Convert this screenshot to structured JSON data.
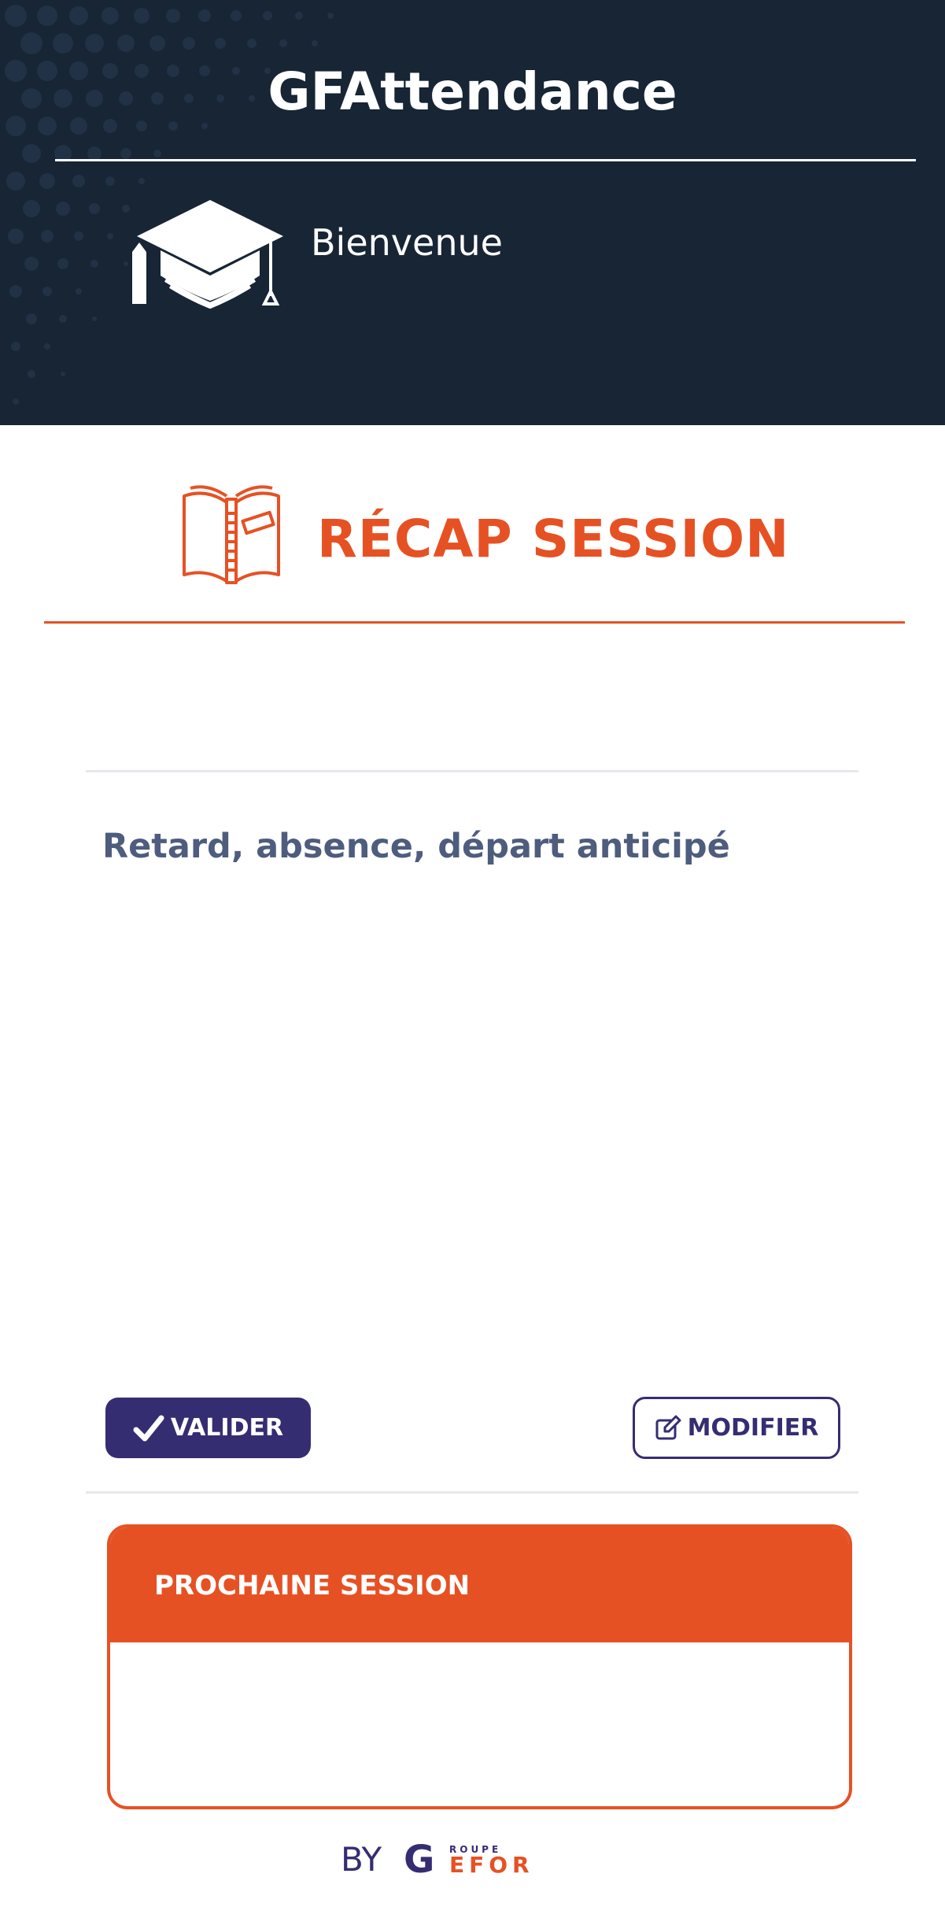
{
  "header": {
    "app_title": "GFAttendance",
    "welcome": "Bienvenue"
  },
  "recap": {
    "title": "RÉCAP SESSION",
    "subheading": "Retard, absence, départ anticipé"
  },
  "actions": {
    "validate_label": "VALIDER",
    "modify_label": "MODIFIER"
  },
  "next_session": {
    "title": "PROCHAINE SESSION"
  },
  "footer": {
    "by": "BY",
    "brand_small": "ROUPE",
    "brand_g": "G",
    "brand_main": "EFOR"
  },
  "colors": {
    "header_bg": "#172535",
    "accent": "#e65124",
    "primary": "#352d72",
    "subheading": "#4e5d7d"
  },
  "icons": {
    "header_icon": "graduation-cap-icon",
    "recap_icon": "open-book-icon",
    "validate_icon": "checkmark-icon",
    "modify_icon": "edit-icon"
  }
}
